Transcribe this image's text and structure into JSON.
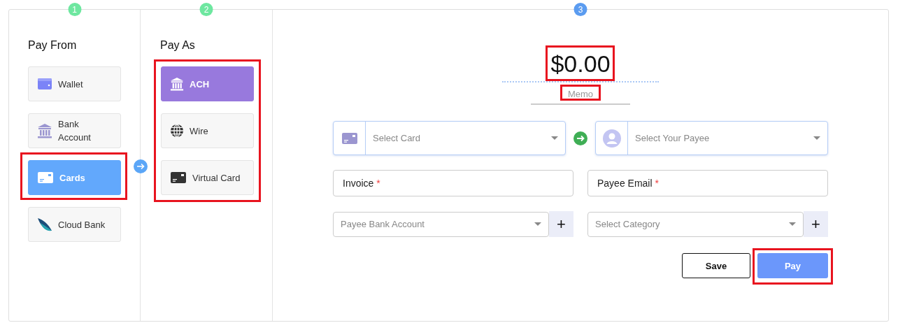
{
  "steps": [
    {
      "number": "1",
      "color": "#6ee7a0"
    },
    {
      "number": "2",
      "color": "#6ee7a0"
    },
    {
      "number": "3",
      "color": "#5b9cf0"
    }
  ],
  "pay_from": {
    "title": "Pay From",
    "items": [
      {
        "label": "Wallet",
        "selected": false,
        "highlighted": false
      },
      {
        "label": "Bank Account",
        "selected": false,
        "highlighted": false
      },
      {
        "label": "Cards",
        "selected": true,
        "highlighted": true
      },
      {
        "label": "Cloud Bank",
        "selected": false,
        "highlighted": false
      }
    ]
  },
  "pay_as": {
    "title": "Pay As",
    "highlighted": true,
    "items": [
      {
        "label": "ACH",
        "selected": true
      },
      {
        "label": "Wire",
        "selected": false
      },
      {
        "label": "Virtual Card",
        "selected": false
      }
    ]
  },
  "payment": {
    "amount": "$0.00",
    "amount_highlighted": true,
    "memo_placeholder": "Memo",
    "memo_highlighted": true,
    "card_select": {
      "placeholder": "Select Card"
    },
    "payee_select": {
      "placeholder": "Select Your Payee"
    },
    "invoice": {
      "label": "Invoice",
      "required_mark": "*"
    },
    "payee_email": {
      "label": "Payee Email",
      "required_mark": "*"
    },
    "bank_account": {
      "placeholder": "Payee Bank Account",
      "add": "+"
    },
    "category": {
      "placeholder": "Select Category",
      "add": "+"
    },
    "buttons": [
      {
        "label": "Save",
        "kind": "secondary",
        "highlighted": false
      },
      {
        "label": "Pay",
        "kind": "primary",
        "highlighted": true
      }
    ]
  }
}
